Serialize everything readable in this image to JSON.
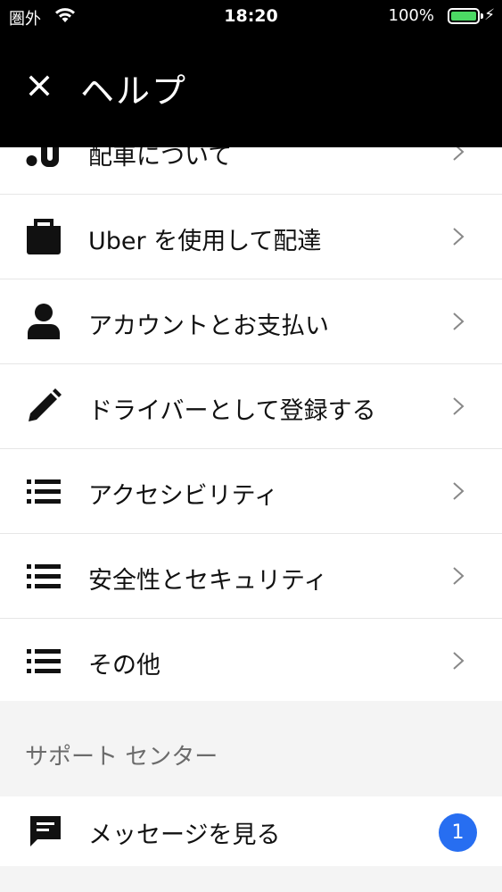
{
  "status_bar": {
    "carrier": "圏外",
    "time": "18:20",
    "battery": "100%",
    "battery_level": 1.0
  },
  "header": {
    "close_icon": "close-icon",
    "title": "ヘルプ"
  },
  "help_items": [
    {
      "label": "配車について",
      "icon": "ride-icon"
    },
    {
      "label": "Uber を使用して配達",
      "icon": "bag-icon"
    },
    {
      "label": "アカウントとお支払い",
      "icon": "person-icon"
    },
    {
      "label": "ドライバーとして登録する",
      "icon": "pencil-icon"
    },
    {
      "label": "アクセシビリティ",
      "icon": "list-icon"
    },
    {
      "label": "安全性とセキュリティ",
      "icon": "list-icon"
    },
    {
      "label": "その他",
      "icon": "list-icon"
    }
  ],
  "support_center": {
    "title": "サポート センター",
    "messages_label": "メッセージを見る",
    "unread_count": "1"
  },
  "colors": {
    "header_bg": "#000000",
    "badge": "#276ef1",
    "battery": "#4cd964"
  }
}
